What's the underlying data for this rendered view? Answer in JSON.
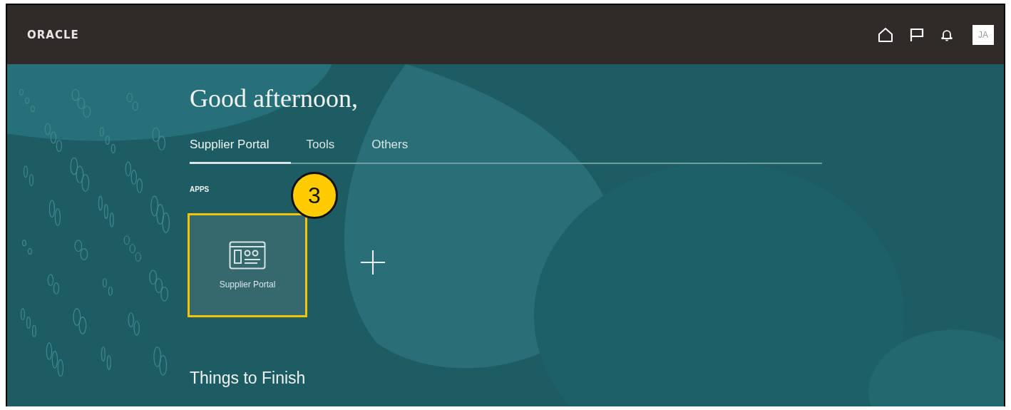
{
  "header": {
    "brand": "ORACLE",
    "icons": [
      {
        "kind": "home"
      },
      {
        "kind": "flag"
      },
      {
        "kind": "bell"
      }
    ],
    "avatar": "JA"
  },
  "greeting": "Good afternoon,",
  "tabs": [
    {
      "label": "Supplier Portal",
      "selected": true
    },
    {
      "label": "Tools",
      "selected": false
    },
    {
      "label": "Others",
      "selected": false
    }
  ],
  "apps_section": {
    "label": "APPS",
    "apps": [
      {
        "label": "Supplier Portal",
        "highlighted": true,
        "callout": "3"
      }
    ]
  },
  "things_to_finish": {
    "title": "Things to Finish"
  }
}
